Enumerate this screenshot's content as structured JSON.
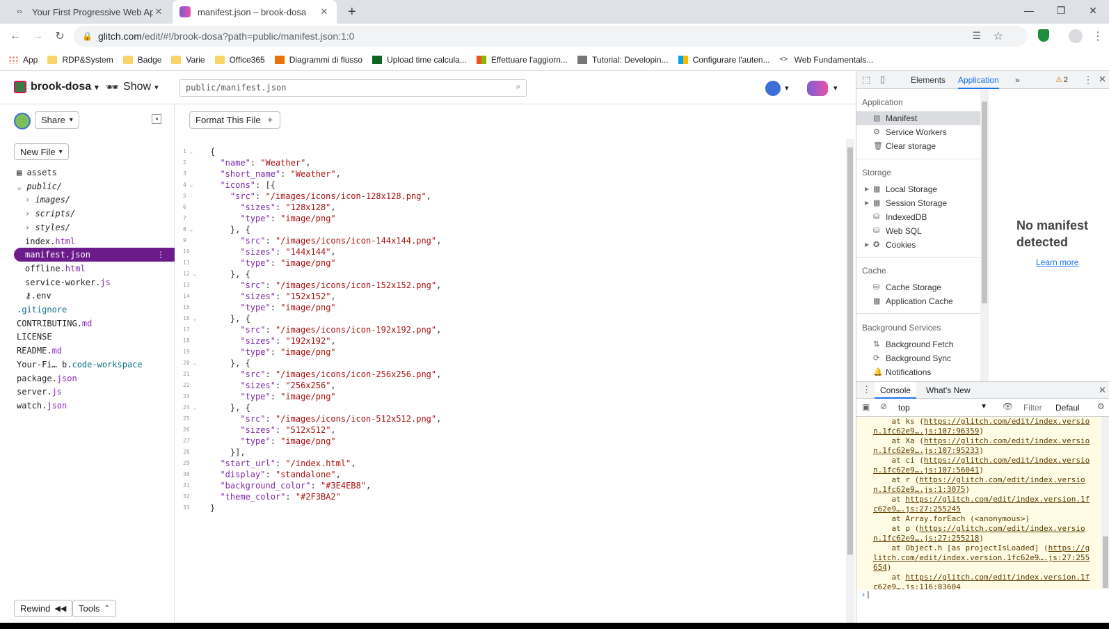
{
  "browser": {
    "tabs": [
      {
        "title": "Your First Progressive Web App",
        "active": false
      },
      {
        "title": "manifest.json – brook-dosa",
        "active": true
      }
    ],
    "new_tab": "+",
    "url_host": "glitch.com",
    "url_path": "/edit/#!/brook-dosa?path=public/manifest.json:1:0",
    "bookmarks": [
      "App",
      "RDP&System",
      "Badge",
      "Varie",
      "Office365",
      "Diagrammi di flusso",
      "Upload time calcula...",
      "Effettuare l'aggiorn...",
      "Tutorial: Developin...",
      "Configurare l'auten...",
      "Web Fundamentals..."
    ]
  },
  "glitch": {
    "project_name": "brook-dosa",
    "show_label": "Show",
    "file_path": "public/manifest.json",
    "share_label": "Share",
    "new_file_label": "New File",
    "format_label": "Format This File",
    "rewind_label": "Rewind",
    "tools_label": "Tools",
    "tree": [
      {
        "name": "assets",
        "ext": "",
        "indent": 0,
        "icon": "assets"
      },
      {
        "name": "public/",
        "ext": "",
        "indent": 0,
        "icon": "folder-open"
      },
      {
        "name": "images/",
        "ext": "",
        "indent": 1,
        "icon": "folder"
      },
      {
        "name": "scripts/",
        "ext": "",
        "indent": 1,
        "icon": "folder"
      },
      {
        "name": "styles/",
        "ext": "",
        "indent": 1,
        "icon": "folder"
      },
      {
        "name": "index.",
        "ext": "html",
        "indent": 1,
        "icon": ""
      },
      {
        "name": "manifest.",
        "ext": "json",
        "indent": 1,
        "icon": "",
        "selected": true
      },
      {
        "name": "offline.",
        "ext": "html",
        "indent": 1,
        "icon": ""
      },
      {
        "name": "service-worker.",
        "ext": "js",
        "indent": 1,
        "icon": ""
      },
      {
        "name": ".env",
        "ext": "",
        "indent": 1,
        "icon": "key"
      },
      {
        "name": ".gitignore",
        "ext": "",
        "indent": 0,
        "icon": ""
      },
      {
        "name": "CONTRIBUTING.",
        "ext": "md",
        "indent": 0,
        "icon": ""
      },
      {
        "name": "LICENSE",
        "ext": "",
        "indent": 0,
        "icon": ""
      },
      {
        "name": "README.",
        "ext": "md",
        "indent": 0,
        "icon": ""
      },
      {
        "name": "Your-Fi… b.",
        "ext": "code-workspace",
        "indent": 0,
        "icon": ""
      },
      {
        "name": "package.",
        "ext": "json",
        "indent": 0,
        "icon": ""
      },
      {
        "name": "server.",
        "ext": "js",
        "indent": 0,
        "icon": ""
      },
      {
        "name": "watch.",
        "ext": "json",
        "indent": 0,
        "icon": ""
      }
    ],
    "code_lines": [
      "{",
      "  \"name\": \"Weather\",",
      "  \"short_name\": \"Weather\",",
      "  \"icons\": [{",
      "    \"src\": \"/images/icons/icon-128x128.png\",",
      "      \"sizes\": \"128x128\",",
      "      \"type\": \"image/png\"",
      "    }, {",
      "      \"src\": \"/images/icons/icon-144x144.png\",",
      "      \"sizes\": \"144x144\",",
      "      \"type\": \"image/png\"",
      "    }, {",
      "      \"src\": \"/images/icons/icon-152x152.png\",",
      "      \"sizes\": \"152x152\",",
      "      \"type\": \"image/png\"",
      "    }, {",
      "      \"src\": \"/images/icons/icon-192x192.png\",",
      "      \"sizes\": \"192x192\",",
      "      \"type\": \"image/png\"",
      "    }, {",
      "      \"src\": \"/images/icons/icon-256x256.png\",",
      "      \"sizes\": \"256x256\",",
      "      \"type\": \"image/png\"",
      "    }, {",
      "      \"src\": \"/images/icons/icon-512x512.png\",",
      "      \"sizes\": \"512x512\",",
      "      \"type\": \"image/png\"",
      "    }],",
      "  \"start_url\": \"/index.html\",",
      "  \"display\": \"standalone\",",
      "  \"background_color\": \"#3E4EB8\",",
      "  \"theme_color\": \"#2F3BA2\"",
      "}"
    ],
    "fold_lines": [
      1,
      4,
      8,
      12,
      16,
      20,
      24
    ]
  },
  "devtools": {
    "tabs": [
      "Elements",
      "Application"
    ],
    "more": "»",
    "warnings": "2",
    "application_section": "Application",
    "application_items": [
      "Manifest",
      "Service Workers",
      "Clear storage"
    ],
    "storage_section": "Storage",
    "storage_items": [
      "Local Storage",
      "Session Storage",
      "IndexedDB",
      "Web SQL",
      "Cookies"
    ],
    "cache_section": "Cache",
    "cache_items": [
      "Cache Storage",
      "Application Cache"
    ],
    "bg_section": "Background Services",
    "bg_items": [
      "Background Fetch",
      "Background Sync",
      "Notifications"
    ],
    "no_manifest_1": "No manifest",
    "no_manifest_2": "detected",
    "learn_more": "Learn more",
    "drawer_tabs": [
      "Console",
      "What's New"
    ],
    "context": "top",
    "filter": "Filter",
    "levels": "Defaul",
    "console_lines": [
      {
        "pre": "    at ks (",
        "link": "https://glitch.com/edit/index.versio",
        "post": ""
      },
      {
        "pre": "",
        "link": "n.1fc62e9….js:107:96359",
        "post": ")"
      },
      {
        "pre": "    at Xa (",
        "link": "https://glitch.com/edit/index.versio",
        "post": ""
      },
      {
        "pre": "",
        "link": "n.1fc62e9….js:107:95233",
        "post": ")"
      },
      {
        "pre": "    at ci (",
        "link": "https://glitch.com/edit/index.versio",
        "post": ""
      },
      {
        "pre": "",
        "link": "n.1fc62e9….js:107:56041",
        "post": ")"
      },
      {
        "pre": "    at r (",
        "link": "https://glitch.com/edit/index.versio",
        "post": ""
      },
      {
        "pre": "",
        "link": "n.1fc62e9….js:1:3075",
        "post": ")"
      },
      {
        "pre": "    at ",
        "link": "https://glitch.com/edit/index.version.1f",
        "post": ""
      },
      {
        "pre": "",
        "link": "c62e9….js:27:255245",
        "post": ""
      },
      {
        "pre": "    at Array.forEach (<anonymous>)",
        "link": "",
        "post": ""
      },
      {
        "pre": "    at p (",
        "link": "https://glitch.com/edit/index.versio",
        "post": ""
      },
      {
        "pre": "",
        "link": "n.1fc62e9….js:27:255218",
        "post": ")"
      },
      {
        "pre": "    at Object.h [as projectIsLoaded] (",
        "link": "https://g",
        "post": ""
      },
      {
        "pre": "",
        "link": "litch.com/edit/index.version.1fc62e9….js:27:255",
        "post": ""
      },
      {
        "pre": "",
        "link": "654",
        "post": ")"
      },
      {
        "pre": "    at ",
        "link": "https://glitch.com/edit/index.version.1f",
        "post": ""
      },
      {
        "pre": "",
        "link": "c62e9….js:116:83604",
        "post": ""
      }
    ]
  }
}
